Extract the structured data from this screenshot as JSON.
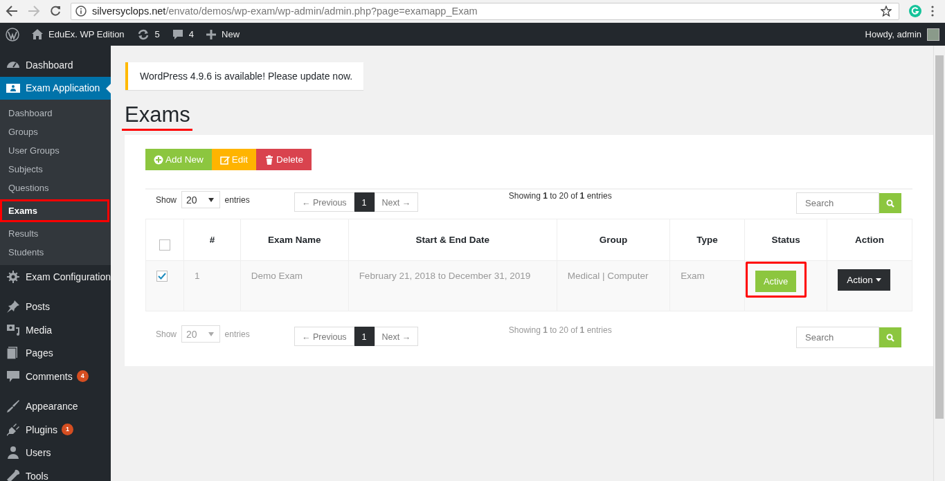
{
  "browser": {
    "url_host": "silversyclops.net",
    "url_path": "/envato/demos/wp-exam/wp-admin/admin.php?page=examapp_Exam"
  },
  "admin_bar": {
    "site": "EduEx. WP Edition",
    "updates": "5",
    "comments": "4",
    "new": "New",
    "greeting": "Howdy, admin"
  },
  "sidebar": {
    "groups": [
      {
        "items": [
          {
            "label": "Dashboard",
            "selected": false
          },
          {
            "label": "Exam Application",
            "selected": true,
            "children": [
              {
                "label": "Dashboard",
                "selected": false,
                "highlighted": false
              },
              {
                "label": "Groups",
                "selected": false,
                "highlighted": false
              },
              {
                "label": "User Groups",
                "selected": false,
                "highlighted": false
              },
              {
                "label": "Subjects",
                "selected": false,
                "highlighted": false
              },
              {
                "label": "Questions",
                "selected": false,
                "highlighted": false
              },
              {
                "label": "Exams",
                "selected": true,
                "highlighted": true
              },
              {
                "label": "Results",
                "selected": false,
                "highlighted": false
              },
              {
                "label": "Students",
                "selected": false,
                "highlighted": false
              }
            ]
          },
          {
            "label": "Exam Configuration",
            "selected": false
          }
        ]
      },
      {
        "items": [
          {
            "label": "Posts",
            "selected": false
          },
          {
            "label": "Media",
            "selected": false
          },
          {
            "label": "Pages",
            "selected": false
          },
          {
            "label": "Comments",
            "selected": false,
            "badge": "4"
          }
        ]
      },
      {
        "items": [
          {
            "label": "Appearance",
            "selected": false
          },
          {
            "label": "Plugins",
            "selected": false,
            "badge": "1"
          },
          {
            "label": "Users",
            "selected": false
          },
          {
            "label": "Tools",
            "selected": false
          }
        ]
      }
    ]
  },
  "notice": {
    "text": "WordPress 4.9.6 is available! Please update now."
  },
  "page_title": {
    "text": "Exams",
    "underlined": true
  },
  "toolbar": [
    {
      "label": "Add New",
      "kind": "add"
    },
    {
      "label": "Edit",
      "kind": "edit"
    },
    {
      "label": "Delete",
      "kind": "delete"
    }
  ],
  "table_controls": [
    {
      "show_label": "Show",
      "page_size": "20",
      "entries_label": "entries",
      "previous": "← Previous",
      "page": "1",
      "next": "Next →",
      "info": "Showing **1** to 20 of **1** entries",
      "search_placeholder": "Search",
      "disabled": false
    },
    {
      "show_label": "Show",
      "page_size": "20",
      "entries_label": "entries",
      "previous": "← Previous",
      "page": "1",
      "next": "Next →",
      "info": "Showing **1** to 20 of **1** entries",
      "search_placeholder": "Search",
      "disabled": true
    }
  ],
  "table": {
    "columns": [
      {
        "kind": "checkbox",
        "checked": false
      },
      {
        "kind": "text",
        "label": "#"
      },
      {
        "kind": "text",
        "label": "Exam Name"
      },
      {
        "kind": "text",
        "label": "Start & End Date"
      },
      {
        "kind": "text",
        "label": "Group"
      },
      {
        "kind": "text",
        "label": "Type"
      },
      {
        "kind": "text",
        "label": "Status"
      },
      {
        "kind": "text",
        "label": "Action"
      }
    ],
    "rows": [
      {
        "checked": true,
        "number": "1",
        "name": "Demo Exam",
        "dates": "February 21, 2018 to December 31, 2019",
        "group": "Medical | Computer",
        "type": "Exam",
        "status": "Active",
        "status_highlighted": true,
        "action": "Action"
      }
    ]
  }
}
